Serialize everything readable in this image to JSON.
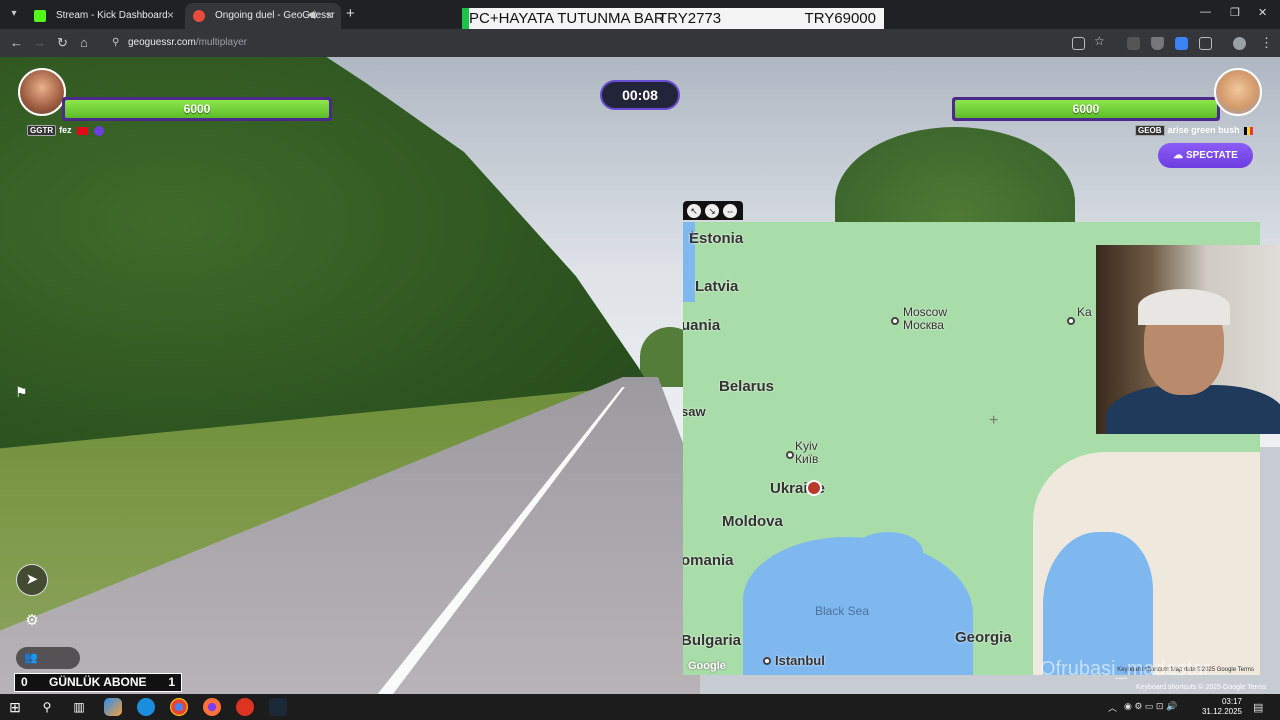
{
  "tabs": [
    {
      "title": "Stream - Kick Dashboard",
      "favicon_color": "#53fc18"
    },
    {
      "title": "Ongoing duel - GeoGuessr",
      "favicon_color": "#e84c3d"
    }
  ],
  "ticker": {
    "text1": "PC+HAYATA TUTUNMA BAR",
    "text2": "TRY2773",
    "text3": "TRY69000"
  },
  "address": {
    "host": "geoguessr.com",
    "path": "/multiplayer"
  },
  "game": {
    "timer": "00:08",
    "player1": {
      "health": "6000",
      "health_fraction": 1.0,
      "badge": "GGTR",
      "name": "fez"
    },
    "player2": {
      "health": "6000",
      "health_fraction": 1.0,
      "badge": "GEOB",
      "name": "arise green bush"
    },
    "spectate_label": "SPECTATE"
  },
  "map": {
    "labels": {
      "estonia": "Estonia",
      "latvia": "Latvia",
      "lithuania": "uania",
      "belarus": "Belarus",
      "ukraine": "Ukraine",
      "moldova": "Moldova",
      "romania": "omania",
      "bulgaria": "Bulgaria",
      "georgia": "Georgia",
      "poland": "saw"
    },
    "cities": {
      "moscow": "Moscow",
      "moscow_ru": "Москва",
      "kyiv": "Kyiv",
      "kyiv_ua": "Київ",
      "istanbul": "Istanbul",
      "ka": "Ka"
    },
    "seas": {
      "black_sea": "Black Sea"
    },
    "google": "Google",
    "attribution": "Keyboard shortcuts   Map data ©2025 Google   Terms"
  },
  "overlay": {
    "abone_count": "0",
    "abone_label": "GÜNLÜK ABONE",
    "abone_value": "1",
    "keyboard_note": "Keyboard shortcuts  © 2025 Google  Terms",
    "watermark": "Ofrubasi_madastar"
  },
  "taskbar": {
    "time": "03:17",
    "date": "31.12.2025"
  }
}
